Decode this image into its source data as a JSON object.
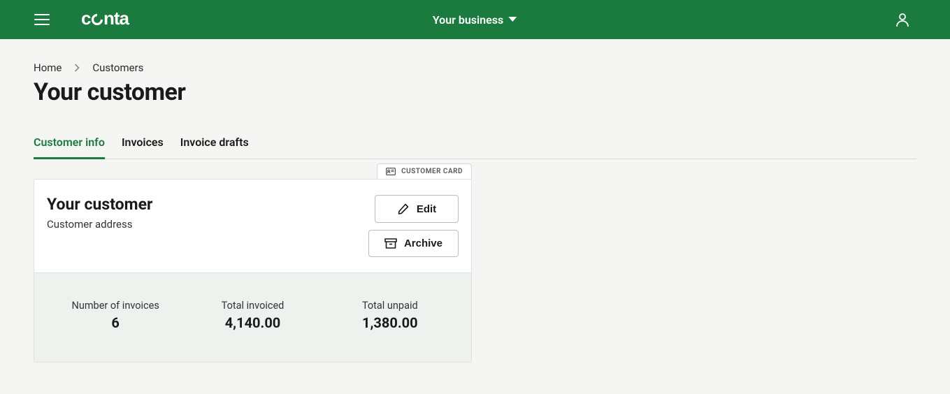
{
  "header": {
    "business_label": "Your business"
  },
  "breadcrumb": {
    "home": "Home",
    "customers": "Customers"
  },
  "page_title": "Your customer",
  "tabs": [
    {
      "label": "Customer info",
      "active": true
    },
    {
      "label": "Invoices",
      "active": false
    },
    {
      "label": "Invoice drafts",
      "active": false
    }
  ],
  "customer_card": {
    "tab_label": "CUSTOMER CARD",
    "name": "Your customer",
    "address": "Customer address",
    "edit_label": "Edit",
    "archive_label": "Archive",
    "stats": {
      "invoices_label": "Number of invoices",
      "invoices_value": "6",
      "invoiced_label": "Total invoiced",
      "invoiced_value": "4,140.00",
      "unpaid_label": "Total unpaid",
      "unpaid_value": "1,380.00"
    }
  }
}
